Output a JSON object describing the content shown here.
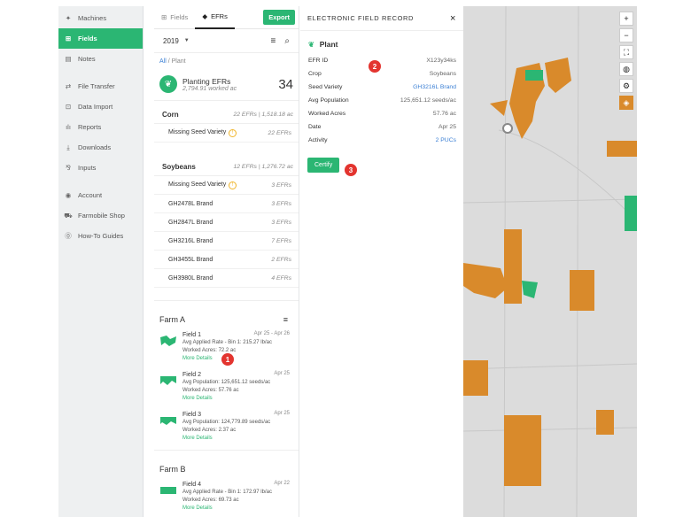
{
  "sidebar": {
    "items": [
      {
        "icon": "✦",
        "label": "Machines"
      },
      {
        "icon": "⊞",
        "label": "Fields"
      },
      {
        "icon": "▤",
        "label": "Notes"
      },
      {
        "icon": "⇄",
        "label": "File Transfer"
      },
      {
        "icon": "⊡",
        "label": "Data Import"
      },
      {
        "icon": "ılı",
        "label": "Reports"
      },
      {
        "icon": "⤓",
        "label": "Downloads"
      },
      {
        "icon": "⅋",
        "label": "Inputs"
      },
      {
        "icon": "◉",
        "label": "Account"
      },
      {
        "icon": "⛟",
        "label": "Farmobile Shop"
      },
      {
        "icon": "⓪",
        "label": "How-To Guides"
      }
    ]
  },
  "list": {
    "tab_fields": "Fields",
    "tab_efrs": "EFRs",
    "export": "Export",
    "year": "2019",
    "crumb_all": "All",
    "crumb_sep": " / ",
    "crumb_current": "Plant",
    "summary_title": "Planting EFRs",
    "summary_sub": "2,794.91 worked ac",
    "summary_count": "34",
    "groups": [
      {
        "name": "Corn",
        "stat": "22 EFRs | 1,518.18 ac",
        "rows": [
          {
            "label": "Missing Seed Variety",
            "warn": true,
            "stat": "22 EFRs"
          }
        ]
      },
      {
        "name": "Soybeans",
        "stat": "12 EFRs | 1,276.72 ac",
        "rows": [
          {
            "label": "Missing Seed Variety",
            "warn": true,
            "stat": "3 EFRs"
          },
          {
            "label": "GH2478L Brand",
            "warn": false,
            "stat": "3 EFRs"
          },
          {
            "label": "GH2847L Brand",
            "warn": false,
            "stat": "3 EFRs"
          },
          {
            "label": "GH3216L Brand",
            "warn": false,
            "stat": "7 EFRs"
          },
          {
            "label": "GH3455L Brand",
            "warn": false,
            "stat": "2 EFRs"
          },
          {
            "label": "GH3980L Brand",
            "warn": false,
            "stat": "4 EFRs"
          }
        ]
      }
    ],
    "farm_a": "Farm A",
    "farm_b": "Farm B",
    "fields": [
      {
        "name": "Field 1",
        "date": "Apr 25 - Apr 26",
        "line1": "Avg Applied Rate - Bin 1: 215.27 lb/ac",
        "line2": "Worked Acres: 72.2 ac",
        "more": "More Details"
      },
      {
        "name": "Field 2",
        "date": "Apr 25",
        "line1": "Avg Population: 125,651.12 seeds/ac",
        "line2": "Worked Acres: 57.76 ac",
        "more": "More Details"
      },
      {
        "name": "Field 3",
        "date": "Apr 25",
        "line1": "Avg Population: 124,779.89 seeds/ac",
        "line2": "Worked Acres: 2.37 ac",
        "more": "More Details"
      },
      {
        "name": "Field 4",
        "date": "Apr 22",
        "line1": "Avg Applied Rate - Bin 1: 172.97 lb/ac",
        "line2": "Worked Acres: 69.73 ac",
        "more": "More Details"
      }
    ]
  },
  "detail": {
    "title": "ELECTRONIC FIELD RECORD",
    "close": "×",
    "section": "Plant",
    "rows": [
      {
        "k": "EFR ID",
        "v": "X123y34ks"
      },
      {
        "k": "Crop",
        "v": "Soybeans"
      },
      {
        "k": "Seed Variety",
        "v": "GH3216L Brand"
      },
      {
        "k": "Avg Population",
        "v": "125,651.12 seeds/ac"
      },
      {
        "k": "Worked Acres",
        "v": "57.76 ac"
      },
      {
        "k": "Date",
        "v": "Apr 25"
      },
      {
        "k": "Activity",
        "v": "2 PUCs"
      }
    ],
    "certify": "Certify"
  },
  "markers": [
    "1",
    "2",
    "3"
  ],
  "map_controls": [
    "+",
    "−",
    "⛶",
    "◍",
    "⚙",
    "◈"
  ],
  "colors": {
    "accent": "#2bb673",
    "marker": "#e3342f",
    "field": "#d98a2b",
    "link": "#3b7fd4"
  }
}
